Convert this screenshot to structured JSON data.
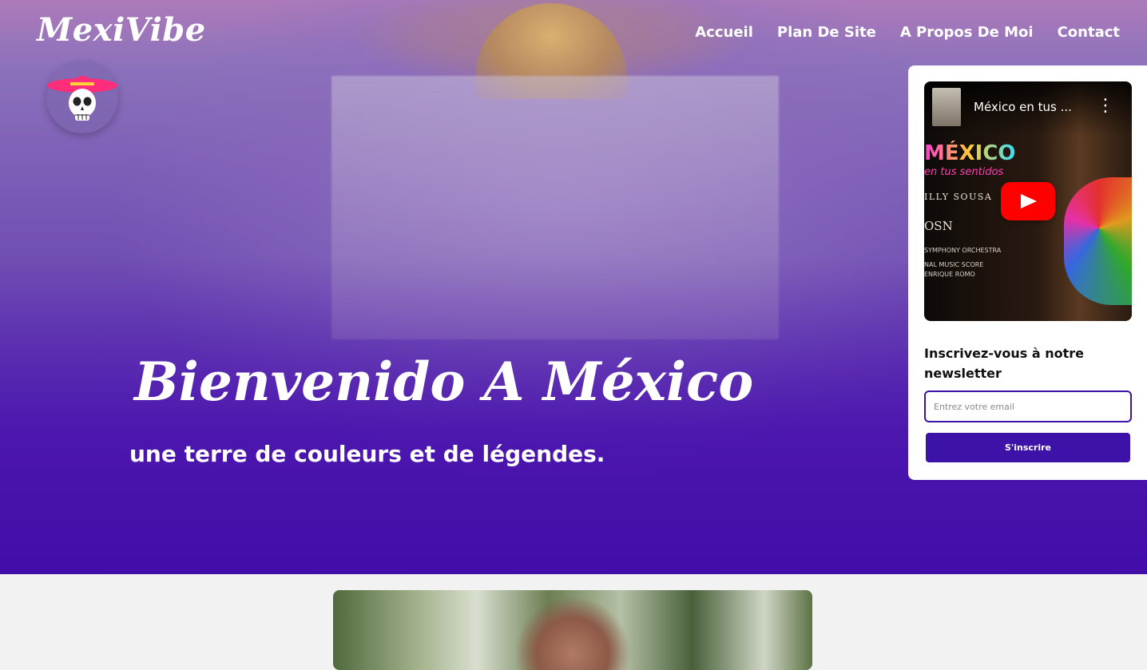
{
  "header": {
    "logo_text": "MexiVibe",
    "nav": [
      "Accueil",
      "Plan De Site",
      "A Propos De Moi",
      "Contact"
    ]
  },
  "hero": {
    "title": "Bienvenido A México",
    "subtitle": "une terre de couleurs et de légendes."
  },
  "video": {
    "title": "México en tus ...",
    "menu_glyph": "⋮",
    "overlay_title": "MÉXICO",
    "overlay_subtitle": "en tus sentidos",
    "overlay_credit": "ILLY SOUSA",
    "overlay_orchestra": "OSN",
    "overlay_lines": [
      "SYMPHONY ORCHESTRA",
      "NAL MUSIC SCORE",
      "ENRIQUE ROMO"
    ]
  },
  "newsletter": {
    "title": "Inscrivez-vous à notre newsletter",
    "email_placeholder": "Entrez votre email",
    "email_value": "",
    "button_label": "S'inscrire"
  },
  "colors": {
    "accent": "#3d12a8",
    "hero_purple": "#4b1fb0",
    "play_red": "#ff0000"
  },
  "icons": {
    "avatar": "sombrero-skull-icon",
    "play": "play-icon",
    "menu": "more-vertical-icon"
  }
}
